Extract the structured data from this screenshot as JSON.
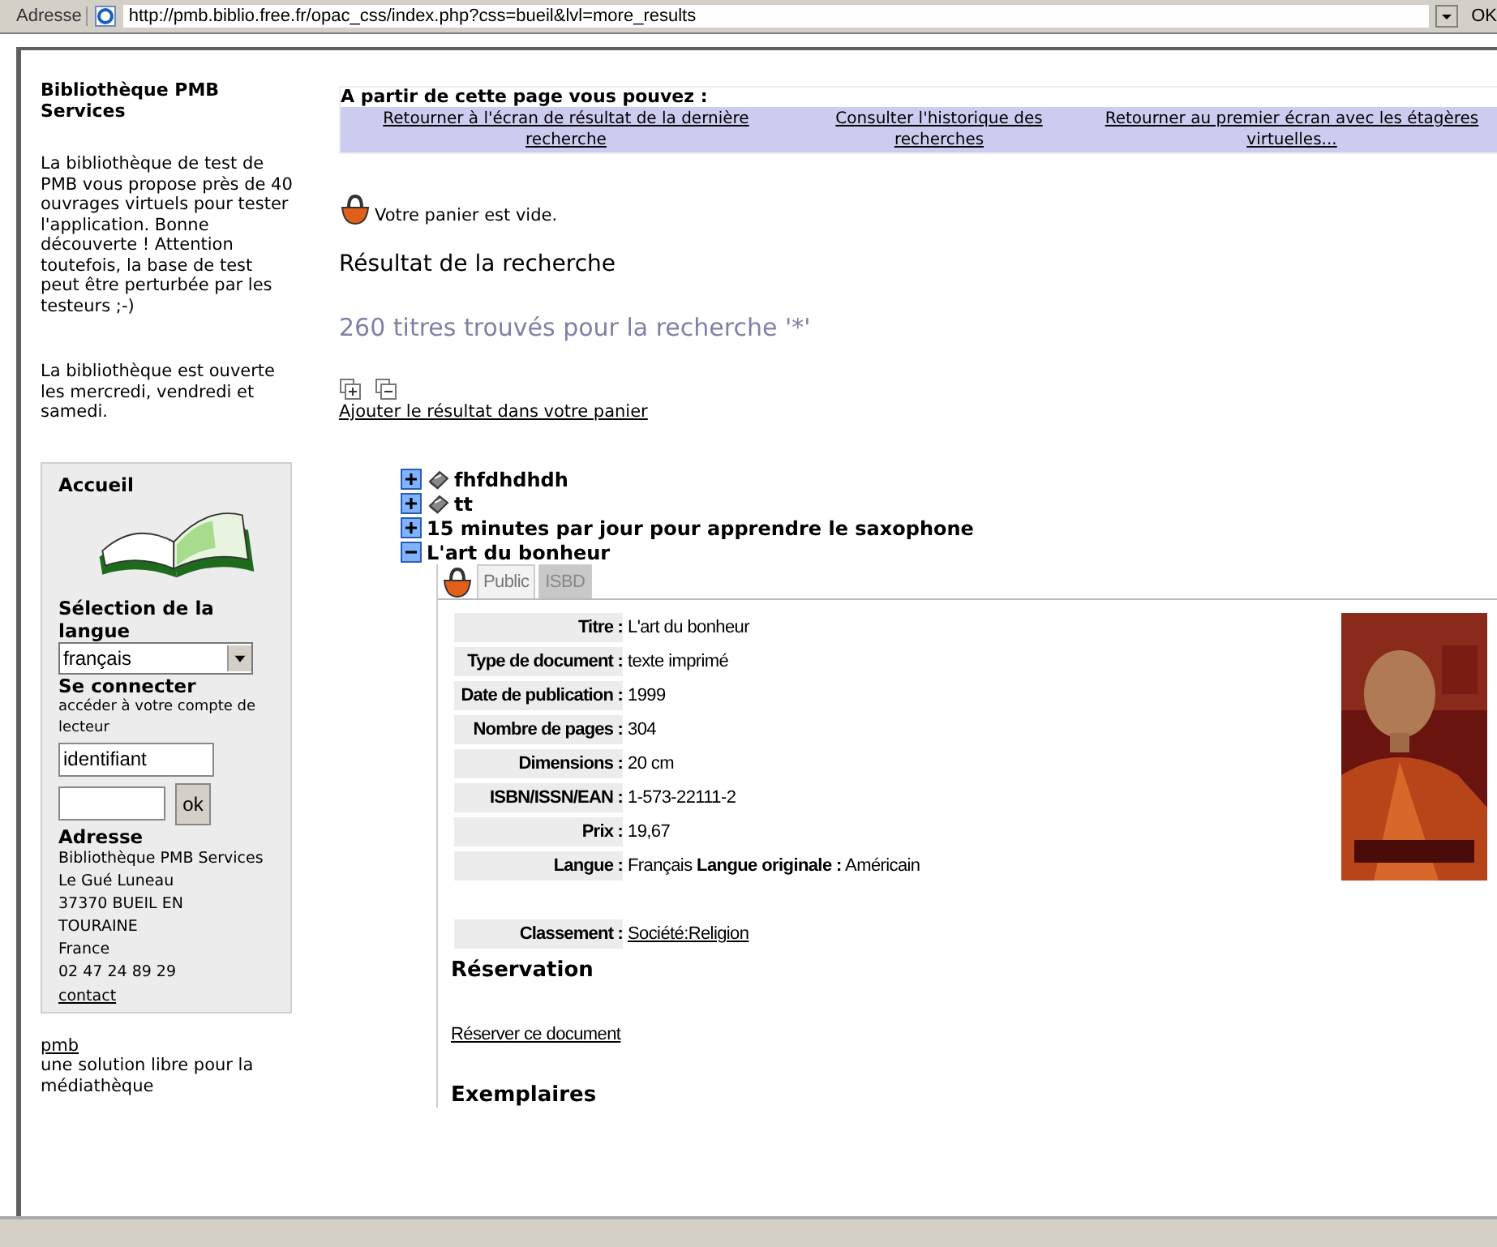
{
  "address_bar": {
    "label": "Adresse",
    "url": "http://pmb.biblio.free.fr/opac_css/index.php?css=bueil&lvl=more_results",
    "go_button": "OK"
  },
  "sidebar": {
    "title": "Bibliothèque PMB Services",
    "paragraphs": [
      "La bibliothèque de test de PMB vous propose près de 40 ouvrages virtuels pour tester l'application. Bonne découverte ! Attention toutefois, la base de test peut être perturbée par les testeurs ;-)",
      "La bibliothèque est ouverte les mercredi, vendredi et samedi."
    ],
    "box": {
      "heading": "Accueil",
      "language_label": "Sélection de la langue",
      "language_value": "français",
      "login_heading": "Se connecter",
      "login_hint": "accéder à votre compte de lecteur",
      "login_value": "identifiant",
      "ok_button": "ok",
      "address_heading": "Adresse",
      "address_lines": [
        "Bibliothèque PMB Services",
        "Le Gué Luneau",
        "37370 BUEIL EN",
        "TOURAINE",
        "France",
        "02 47 24 89 29"
      ],
      "contact_link": "contact"
    },
    "footer_link": "pmb",
    "footer_text": "une solution libre pour la médiathèque"
  },
  "main": {
    "actions_heading": "A partir de cette page vous pouvez :",
    "actions": [
      "Retourner à l'écran de résultat de la dernière recherche",
      "Consulter l'historique des recherches",
      "Retourner au premier écran avec les étagères virtuelles..."
    ],
    "cart_message": "Votre panier est vide.",
    "result_title": "Résultat de la recherche",
    "result_count": "260 titres trouvés pour la recherche '*'",
    "add_to_cart_link": "Ajouter le résultat dans votre panier",
    "results": [
      {
        "title": "fhfdhdhdh",
        "kind": "book",
        "expanded": false
      },
      {
        "title": "tt",
        "kind": "book",
        "expanded": false
      },
      {
        "title": "15 minutes par jour pour apprendre le saxophone",
        "kind": "plain",
        "expanded": false
      },
      {
        "title": "L'art du bonheur",
        "kind": "plain",
        "expanded": true
      }
    ],
    "detail": {
      "tabs": [
        {
          "label": "Public",
          "selected": true
        },
        {
          "label": "ISBD",
          "selected": false
        }
      ],
      "rows": [
        {
          "label": "Titre :",
          "value": "L'art du bonheur"
        },
        {
          "label": "Type de document :",
          "value": "texte imprimé"
        },
        {
          "label": "Date de publication :",
          "value": "1999"
        },
        {
          "label": "Nombre de pages :",
          "value": "304"
        },
        {
          "label": "Dimensions :",
          "value": "20 cm"
        },
        {
          "label": "ISBN/ISSN/EAN :",
          "value": "1-573-22111-2"
        },
        {
          "label": "Prix :",
          "value": "19,67"
        },
        {
          "label": "Langue :",
          "value": "Français **Langue originale :** Américain"
        }
      ],
      "classification": {
        "label": "Classement :",
        "value": "Société:Religion"
      },
      "reservation_heading": "Réservation",
      "reserve_link": "Réserver ce document",
      "copies_heading": "Exemplaires"
    }
  }
}
